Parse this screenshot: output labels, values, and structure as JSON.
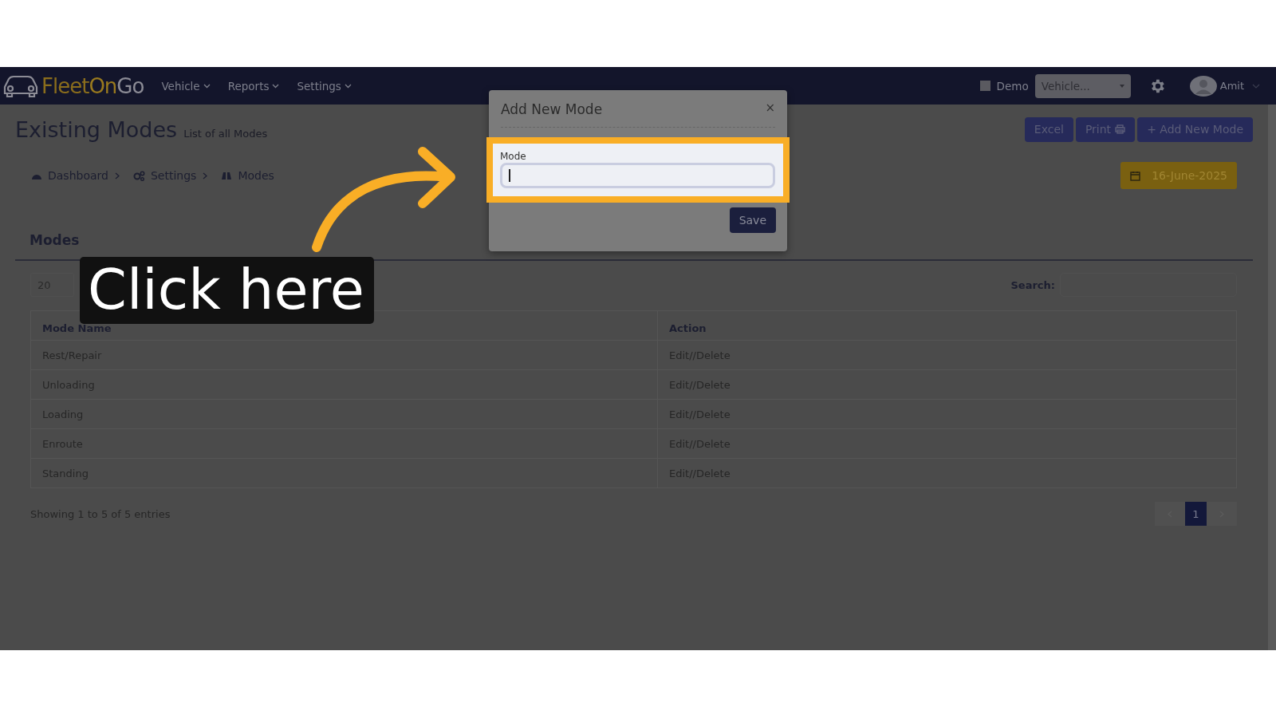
{
  "navbar": {
    "logo_parts": [
      "Fleet",
      "On",
      "Go"
    ],
    "menus": [
      {
        "label": "Vehicle"
      },
      {
        "label": "Reports"
      },
      {
        "label": "Settings"
      }
    ],
    "demo": {
      "label": "Demo",
      "checked": false
    },
    "vehicle_select": {
      "placeholder": "Vehicle..."
    },
    "user": "Amit"
  },
  "header": {
    "title": "Existing Modes",
    "subtitle": "List of all Modes",
    "buttons": [
      {
        "label": "Excel",
        "kind": "plain"
      },
      {
        "label": "Print",
        "kind": "print"
      },
      {
        "label": "+ Add New Mode",
        "kind": "plain"
      }
    ]
  },
  "breadcrumb": [
    {
      "label": "Dashboard",
      "kind": "dashboard"
    },
    {
      "label": "Settings",
      "kind": "settings"
    },
    {
      "label": "Modes",
      "kind": "modes"
    }
  ],
  "date": "16-June-2025",
  "card": {
    "heading": "Modes",
    "entries": "20",
    "search_label": "Search:",
    "columns": [
      "Mode Name",
      "Action"
    ],
    "rows": [
      {
        "name": "Rest/Repair",
        "action": "Edit//Delete"
      },
      {
        "name": "Unloading",
        "action": "Edit//Delete"
      },
      {
        "name": "Loading",
        "action": "Edit//Delete"
      },
      {
        "name": "Enroute",
        "action": "Edit//Delete"
      },
      {
        "name": "Standing",
        "action": "Edit//Delete"
      }
    ],
    "info": "Showing 1 to 5 of 5 entries",
    "pages": [
      {
        "label": "1",
        "selected": true
      }
    ]
  },
  "modal": {
    "title": "Add New Mode",
    "close": "×",
    "field_label": "Mode",
    "save": "Save"
  },
  "callout": "Click here"
}
